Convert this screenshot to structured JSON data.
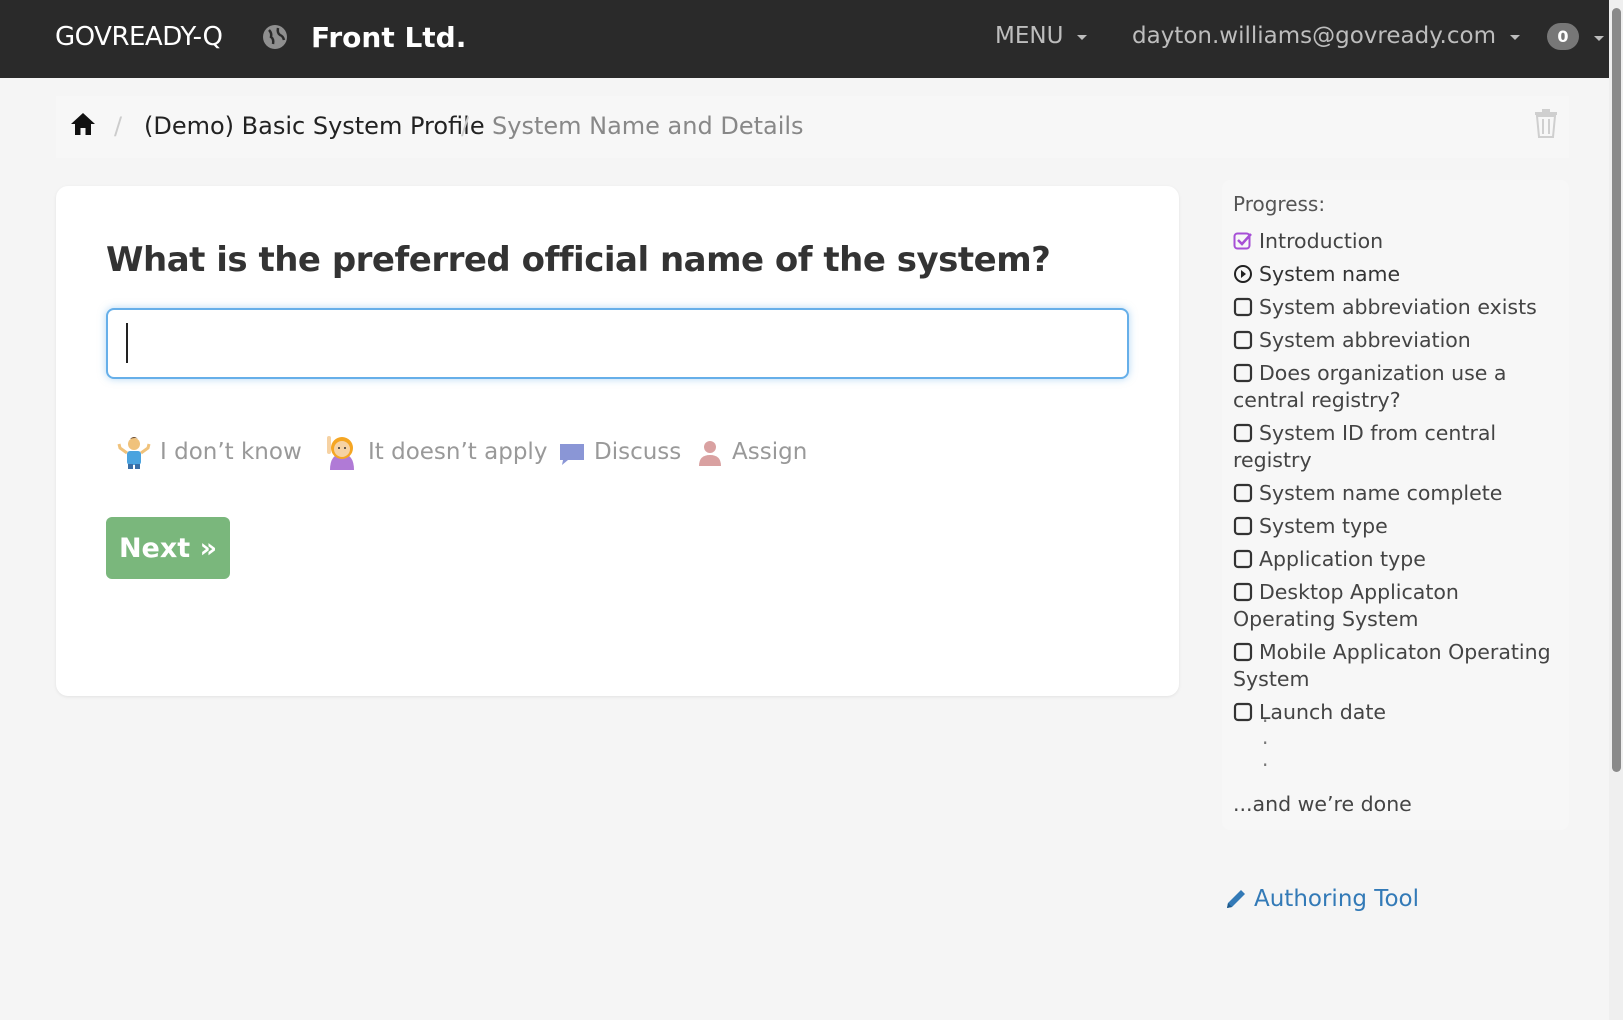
{
  "navbar": {
    "brand": "GOVREADY-Q",
    "org_name": "Front Ltd.",
    "menu_label": "MENU",
    "user_email": "dayton.williams@govready.com",
    "notification_count": "0"
  },
  "breadcrumb": {
    "items": [
      "(Demo) Basic System Profile",
      "System Name and Details"
    ],
    "separator": "/"
  },
  "question": {
    "text": "What is the preferred official name of the system?",
    "answer_value": "",
    "answer_placeholder": ""
  },
  "actions": {
    "dont_know": "I don’t know",
    "doesnt_apply": "It doesn’t apply",
    "discuss": "Discuss",
    "assign": "Assign"
  },
  "next_label": "Next »",
  "progress": {
    "title": "Progress:",
    "items": [
      {
        "label": "Introduction",
        "state": "done"
      },
      {
        "label": "System name",
        "state": "current"
      },
      {
        "label": "System abbreviation exists",
        "state": "todo"
      },
      {
        "label": "System abbreviation",
        "state": "todo"
      },
      {
        "label": "Does organization use a central registry?",
        "state": "todo"
      },
      {
        "label": "System ID from central registry",
        "state": "todo"
      },
      {
        "label": "System name complete",
        "state": "todo"
      },
      {
        "label": "System type",
        "state": "todo"
      },
      {
        "label": "Application type",
        "state": "todo"
      },
      {
        "label": "Desktop Applicaton Operating System",
        "state": "todo"
      },
      {
        "label": "Mobile Applicaton Operating System",
        "state": "todo"
      },
      {
        "label": "Launch date",
        "state": "todo"
      }
    ],
    "done_text": "...and we’re done"
  },
  "authoring_tool_label": "Authoring Tool",
  "colors": {
    "navbar_bg": "#2a2a2a",
    "next_button": "#7ab77c",
    "link": "#337ab7",
    "done_check": "#a64fd6",
    "input_focus": "#66afe9"
  }
}
